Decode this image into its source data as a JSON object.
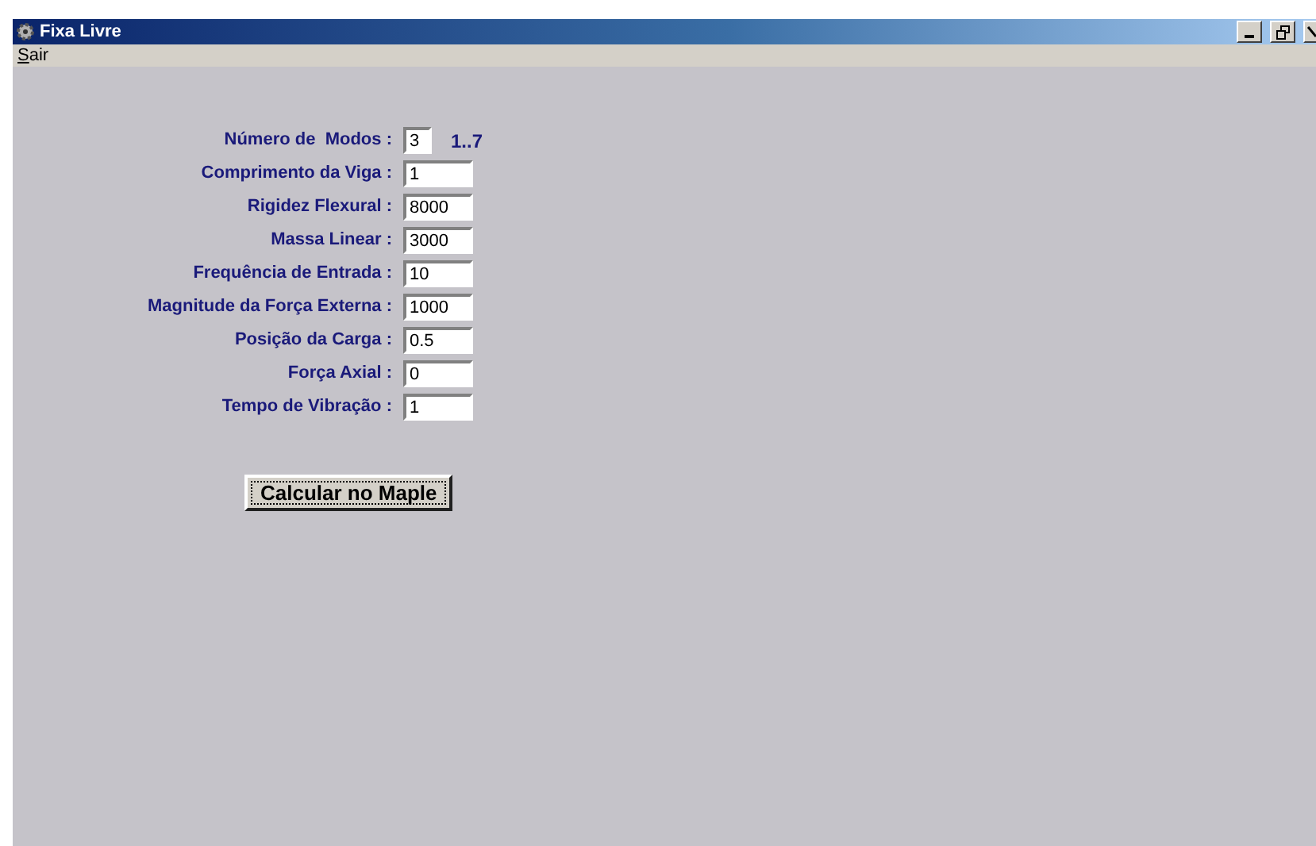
{
  "window": {
    "title": "Fixa Livre"
  },
  "menu": [
    "Sair"
  ],
  "fields": [
    {
      "label": "Número de  Modos :",
      "value": "3",
      "kind": "short",
      "hint": "1..7"
    },
    {
      "label": "Comprimento da Viga :",
      "value": "1",
      "kind": "normal"
    },
    {
      "label": "Rigidez Flexural :",
      "value": "8000",
      "kind": "normal"
    },
    {
      "label": "Massa Linear :",
      "value": "3000",
      "kind": "normal"
    },
    {
      "label": "Frequência de Entrada :",
      "value": "10",
      "kind": "normal"
    },
    {
      "label": "Magnitude da Força Externa :",
      "value": "1000",
      "kind": "normal"
    },
    {
      "label": "Posição da Carga :",
      "value": "0.5",
      "kind": "normal"
    },
    {
      "label": "Força Axial :",
      "value": "0",
      "kind": "normal"
    },
    {
      "label": "Tempo de Vibração :",
      "value": "1",
      "kind": "normal"
    }
  ],
  "button": "Calcular no Maple"
}
